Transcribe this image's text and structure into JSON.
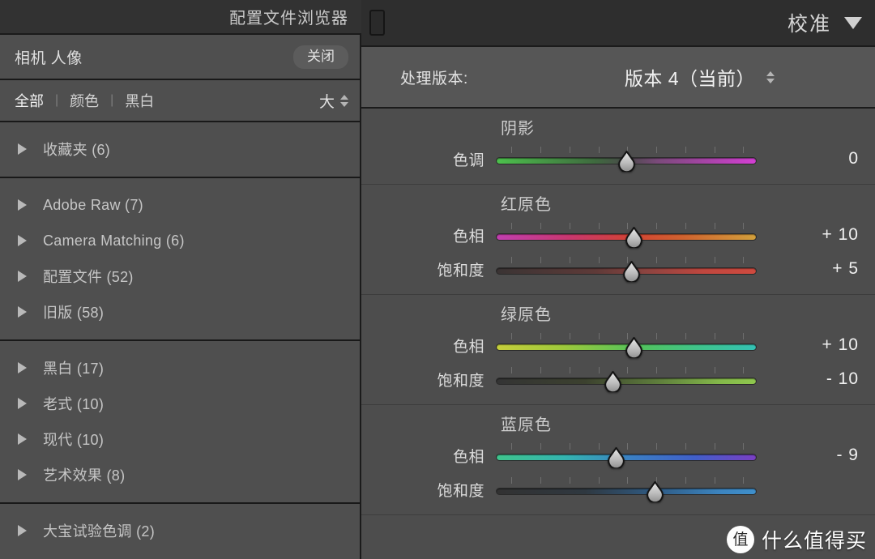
{
  "browser": {
    "title": "配置文件浏览器",
    "filter_title": "相机 人像",
    "close_label": "关闭",
    "tabs": [
      {
        "label": "全部",
        "active": true
      },
      {
        "label": "颜色",
        "active": false
      },
      {
        "label": "黑白",
        "active": false
      }
    ],
    "tab_separator": "|",
    "size_label": "大",
    "groups": [
      {
        "items": [
          {
            "label": "收藏夹 (6)",
            "name": "收藏夹",
            "count": 6
          }
        ]
      },
      {
        "items": [
          {
            "label": "Adobe Raw (7)",
            "name": "Adobe Raw",
            "count": 7
          },
          {
            "label": "Camera Matching (6)",
            "name": "Camera Matching",
            "count": 6
          },
          {
            "label": "配置文件 (52)",
            "name": "配置文件",
            "count": 52
          },
          {
            "label": "旧版 (58)",
            "name": "旧版",
            "count": 58
          }
        ]
      },
      {
        "items": [
          {
            "label": "黑白 (17)",
            "name": "黑白",
            "count": 17
          },
          {
            "label": "老式 (10)",
            "name": "老式",
            "count": 10
          },
          {
            "label": "现代 (10)",
            "name": "现代",
            "count": 10
          },
          {
            "label": "艺术效果 (8)",
            "name": "艺术效果",
            "count": 8
          }
        ]
      },
      {
        "items": [
          {
            "label": "大宝试验色调 (2)",
            "name": "大宝试验色调",
            "count": 2
          }
        ]
      }
    ]
  },
  "calibration": {
    "title": "校准",
    "process_label": "处理版本:",
    "process_value": "版本 4（当前）",
    "sections": [
      {
        "title": "阴影",
        "sliders": [
          {
            "label": "色调",
            "value": "0",
            "position": 50,
            "gradient": "linear-gradient(to right, #4cc04c 0%, #3f6a3f 38%, #4a4a4a 50%, #7a4a7a 62%, #d43fd4 100%)"
          }
        ]
      },
      {
        "title": "红原色",
        "sliders": [
          {
            "label": "色相",
            "value": "+ 10",
            "position": 53,
            "gradient": "linear-gradient(to right, #c13fb0 0%, #c9376f 28%, #d24334 52%, #d1632f 72%, #d2a03c 100%)"
          },
          {
            "label": "饱和度",
            "value": "+ 5",
            "position": 52,
            "gradient": "linear-gradient(to right, #3a3434 0%, #5e3a38 38%, #8d4440 58%, #c0473f 80%, #cf4a3f 100%)"
          }
        ]
      },
      {
        "title": "绿原色",
        "sliders": [
          {
            "label": "色相",
            "value": "+ 10",
            "position": 53,
            "gradient": "linear-gradient(to right, #c6cf3c 0%, #9ec93c 26%, #53c35a 54%, #3fc48c 78%, #34c2b4 100%)"
          },
          {
            "label": "饱和度",
            "value": "- 10",
            "position": 45,
            "gradient": "linear-gradient(to right, #343434 0%, #3c412f 34%, #5e7d3c 62%, #84b84a 86%, #8fc84e 100%)"
          }
        ]
      },
      {
        "title": "蓝原色",
        "sliders": [
          {
            "label": "色相",
            "value": "- 9",
            "position": 46,
            "gradient": "linear-gradient(to right, #3fc48c 0%, #34b5b0 26%, #3b7fc4 52%, #4060c9 76%, #7a3fc4 100%)"
          },
          {
            "label": "饱和度",
            "value": "",
            "position": 61,
            "gradient": "linear-gradient(to right, #323232 0%, #2f3840 34%, #2f5c86 62%, #3c84bf 86%, #3f90cc 100%)"
          }
        ]
      }
    ]
  },
  "watermark": {
    "badge": "值",
    "text": "什么值得买"
  }
}
